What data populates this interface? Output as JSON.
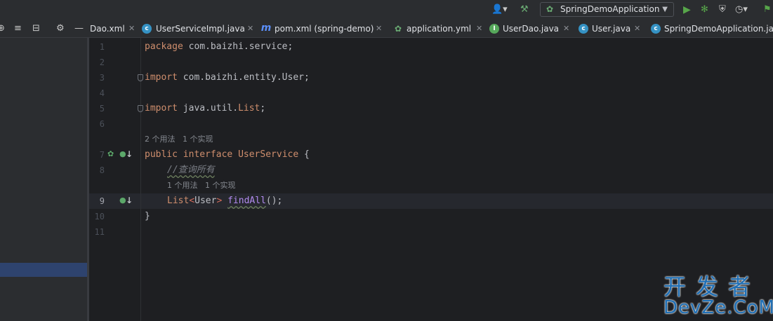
{
  "toolbar": {
    "run_config": "SpringDemoApplication",
    "icons": [
      "user-icon",
      "hammer-icon",
      "run-icon",
      "debug-icon",
      "coverage-icon",
      "profile-icon",
      "more-icon"
    ]
  },
  "panel_header": {
    "icons": [
      "locate-icon",
      "expand-all-icon",
      "collapse-all-icon",
      "gear-icon",
      "minimize-icon"
    ]
  },
  "tabs": [
    {
      "label": "Dao.xml",
      "icon": "xml-icon"
    },
    {
      "label": "UserServiceImpl.java",
      "icon": "class-icon"
    },
    {
      "label": "pom.xml (spring-demo)",
      "icon": "maven-icon"
    },
    {
      "label": "application.yml",
      "icon": "spring-yaml-icon"
    },
    {
      "label": "UserDao.java",
      "icon": "interface-icon"
    },
    {
      "label": "User.java",
      "icon": "class-icon"
    },
    {
      "label": "SpringDemoApplication.java",
      "icon": "spring-class-icon"
    }
  ],
  "editor": {
    "line_numbers": [
      "1",
      "2",
      "3",
      "4",
      "5",
      "6",
      "7",
      "8",
      "9",
      "10",
      "11"
    ],
    "current_line": "9",
    "code": {
      "l1_kw": "package",
      "l1_rest": " com.baizhi.service;",
      "l3_kw": "import",
      "l3_rest": " com.baizhi.entity.User;",
      "l5_kw": "import",
      "l5_rest": " java.util.",
      "l5_cls": "List",
      "l5_end": ";",
      "l7_kw1": "public",
      "l7_kw2": "interface",
      "l7_name": "UserService",
      "l7_end": " {",
      "l8_cmt": "//查询所有",
      "l9_type": "List",
      "l9_lt": "<",
      "l9_user": "User",
      "l9_gt": ">",
      "l9_fn": "findAll",
      "l9_end": "();",
      "l10": "}"
    },
    "hints": {
      "interface_usage": "2 个用法   1 个实现",
      "method_usage": "1 个用法   1 个实现"
    }
  },
  "watermark": {
    "cn": "开发者",
    "en": "DevZe.CoM"
  }
}
